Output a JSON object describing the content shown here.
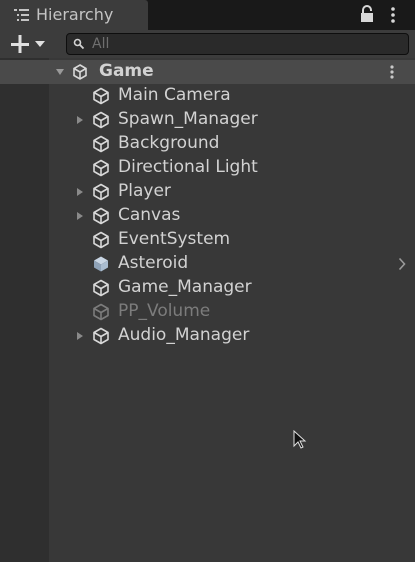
{
  "panel": {
    "tab_label": "Hierarchy",
    "tab_icon": "hierarchy-list-icon",
    "lock_icon": "lock-icon",
    "menu_icon": "kebab-menu-icon"
  },
  "toolbar": {
    "add_icon": "plus-dropdown-icon",
    "search_placeholder": "All",
    "search_value": ""
  },
  "scene": {
    "name": "Game",
    "icon": "unity-scene-icon",
    "expanded": true
  },
  "objects": [
    {
      "name": "Main Camera",
      "has_children": false,
      "state": "active"
    },
    {
      "name": "Spawn_Manager",
      "has_children": true,
      "state": "active"
    },
    {
      "name": "Background",
      "has_children": false,
      "state": "active"
    },
    {
      "name": "Directional Light",
      "has_children": false,
      "state": "active"
    },
    {
      "name": "Player",
      "has_children": true,
      "state": "active"
    },
    {
      "name": "Canvas",
      "has_children": true,
      "state": "active"
    },
    {
      "name": "EventSystem",
      "has_children": false,
      "state": "active"
    },
    {
      "name": "Asteroid",
      "has_children": false,
      "state": "prefab",
      "has_chevron": true
    },
    {
      "name": "Game_Manager",
      "has_children": false,
      "state": "active"
    },
    {
      "name": "PP_Volume",
      "has_children": false,
      "state": "inactive"
    },
    {
      "name": "Audio_Manager",
      "has_children": true,
      "state": "active"
    }
  ],
  "colors": {
    "panel_bg": "#383838",
    "gutter_bg": "#2f2f2f",
    "scene_row_bg": "#4a4a4a",
    "text": "#d2d2d2",
    "inactive_text": "#7c7c7c",
    "prefab_icon": "#9fb3c8"
  }
}
